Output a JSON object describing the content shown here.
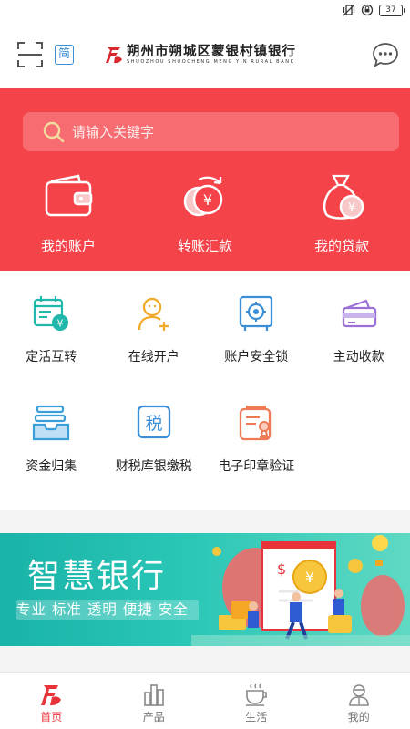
{
  "status_bar": {
    "battery": "37"
  },
  "header": {
    "simplified_badge": "简",
    "bank_name_cn": "朔州市朔城区蒙银村镇银行",
    "bank_name_en": "SHUOZHOU SHUOCHENG MENG YIN RURAL BANK"
  },
  "search": {
    "placeholder": "请输入关键字"
  },
  "hero": {
    "items": [
      {
        "label": "我的账户",
        "icon": "wallet-icon"
      },
      {
        "label": "转账汇款",
        "icon": "transfer-icon"
      },
      {
        "label": "我的贷款",
        "icon": "loan-bag-icon"
      }
    ]
  },
  "grid": {
    "items": [
      {
        "label": "定活互转",
        "icon": "calendar-yuan-icon"
      },
      {
        "label": "在线开户",
        "icon": "add-user-icon"
      },
      {
        "label": "账户安全锁",
        "icon": "safe-icon"
      },
      {
        "label": "主动收款",
        "icon": "cards-icon"
      },
      {
        "label": "资金归集",
        "icon": "tray-icon"
      },
      {
        "label": "财税库银缴税",
        "icon": "tax-icon"
      },
      {
        "label": "电子印章验证",
        "icon": "seal-icon"
      }
    ]
  },
  "banner": {
    "title": "智慧银行",
    "slogan": "专业 标准 透明 便捷 安全"
  },
  "tabbar": {
    "tabs": [
      {
        "label": "首页",
        "icon": "home-logo-icon",
        "active": true
      },
      {
        "label": "产品",
        "icon": "product-bars-icon",
        "active": false
      },
      {
        "label": "生活",
        "icon": "coffee-cup-icon",
        "active": false
      },
      {
        "label": "我的",
        "icon": "profile-icon",
        "active": false
      }
    ]
  },
  "colors": {
    "brand_red": "#f5434a",
    "accent_blue": "#3b8fd8",
    "banner_teal": "#1fb8aa"
  }
}
